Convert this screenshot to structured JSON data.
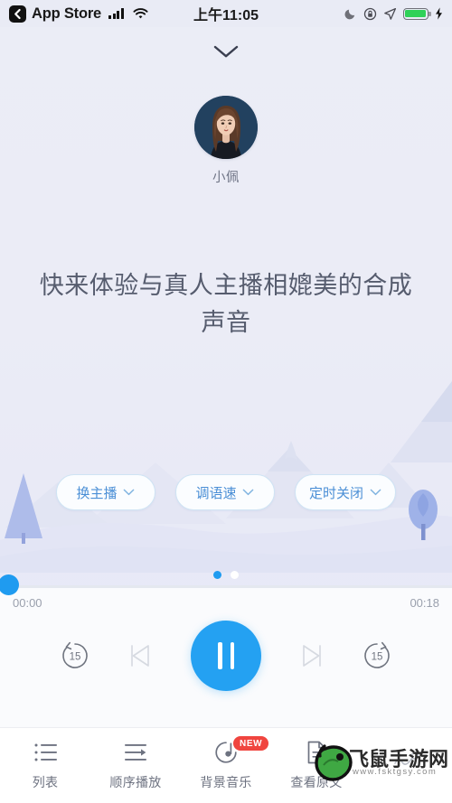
{
  "status_bar": {
    "back_app": "App Store",
    "time": "上午11:05",
    "icons": {
      "back_chevron": "chevron-left-icon",
      "signal": "cellular-signal-icon",
      "wifi": "wifi-icon",
      "dnd": "moon-do-not-disturb-icon",
      "rotation_lock": "rotation-lock-icon",
      "location": "location-arrow-icon",
      "battery": "battery-icon",
      "charging": "lightning-charging-icon"
    },
    "battery_color": "#2fd158"
  },
  "header": {
    "collapse_icon": "chevron-down-icon"
  },
  "speaker": {
    "name": "小佩",
    "avatar_icon": "female-avatar-illustration",
    "avatar_bg": "#22415f"
  },
  "main": {
    "headline": "快来体验与真人主播相媲美的合成声音"
  },
  "options": [
    {
      "label": "换主播",
      "icon": "chevron-down-icon"
    },
    {
      "label": "调语速",
      "icon": "chevron-down-icon"
    },
    {
      "label": "定时关闭",
      "icon": "chevron-down-icon"
    }
  ],
  "pagination": {
    "total": 2,
    "active_index": 0,
    "active_color": "#1f9bf0",
    "inactive_color": "#ffffff"
  },
  "player": {
    "current_time": "00:00",
    "total_time": "00:18",
    "progress_percent": 0,
    "accent_color": "#24a1f2",
    "is_playing": true,
    "controls": [
      {
        "name": "rewind-15-icon",
        "label": "15"
      },
      {
        "name": "previous-track-icon",
        "label": ""
      },
      {
        "name": "pause-icon",
        "label": ""
      },
      {
        "name": "next-track-icon",
        "label": ""
      },
      {
        "name": "forward-15-icon",
        "label": "15"
      }
    ]
  },
  "tabbar": {
    "items": [
      {
        "label": "列表",
        "icon": "list-icon",
        "badge": ""
      },
      {
        "label": "顺序播放",
        "icon": "sequential-play-icon",
        "badge": ""
      },
      {
        "label": "背景音乐",
        "icon": "music-note-icon",
        "badge": "NEW"
      },
      {
        "label": "查看原文",
        "icon": "document-icon",
        "badge": ""
      },
      {
        "label": "",
        "icon": "share-icon",
        "badge": ""
      }
    ],
    "badge_color": "#f0453f"
  },
  "watermark": {
    "title": "飞鼠手游网",
    "url": "www.fsktgsy.com",
    "logo_icon": "green-mouse-logo"
  }
}
